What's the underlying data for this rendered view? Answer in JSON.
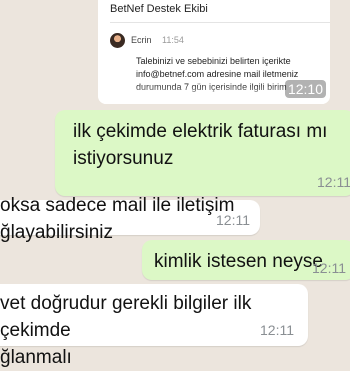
{
  "card": {
    "signature": "BetNef Destek Ekibi",
    "contact_name": "Ecrin",
    "contact_time": "11:54",
    "body_lines": [
      "Talebinizi ve sebebinizi belirten içerikte",
      "info@betnef.com adresine mail iletmeniz",
      "durumunda 7 gün içerisinde ilgili birim"
    ],
    "timestamp": "12:10"
  },
  "messages": [
    {
      "direction": "outgoing",
      "lines": [
        "ilk çekimde elektrik faturası mı",
        "istiyorsunuz"
      ],
      "time": "12:11"
    },
    {
      "direction": "incoming",
      "lines": [
        "oksa sadece mail ile iletişim",
        "ğlayabilirsiniz"
      ],
      "time": "12:11"
    },
    {
      "direction": "outgoing",
      "lines": [
        "kimlik istesen neyse"
      ],
      "time": "12:11"
    },
    {
      "direction": "incoming",
      "lines": [
        "vet doğrudur gerekli bilgiler ilk çekimde",
        "ğlanmalı"
      ],
      "time": "12:11"
    }
  ]
}
